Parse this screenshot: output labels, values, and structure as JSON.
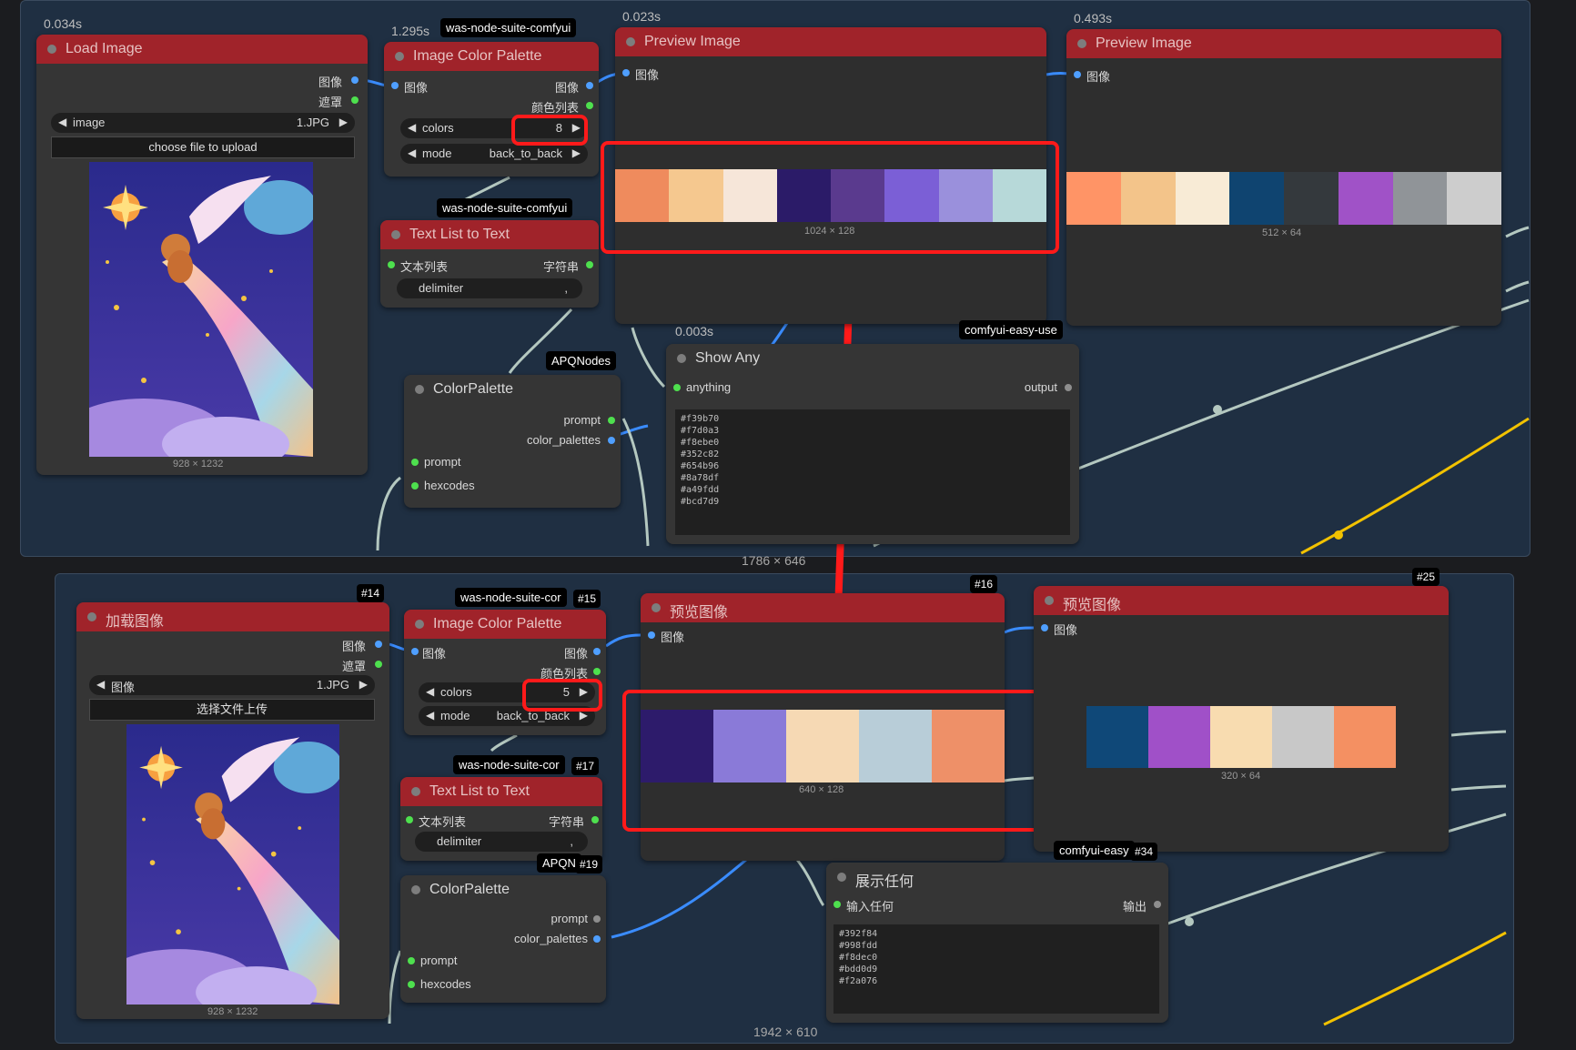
{
  "top": {
    "size_label": "1786 × 646",
    "load_image": {
      "timing": "0.034s",
      "title": "Load Image",
      "out_image": "图像",
      "out_mask": "遮罩",
      "image_label": "image",
      "image_value": "1.JPG",
      "upload_label": "choose file to upload",
      "dims": "928 × 1232"
    },
    "color_palette_node": {
      "timing": "1.295s",
      "badge": "was-node-suite-comfyui",
      "title": "Image Color Palette",
      "in_image": "图像",
      "out_image": "图像",
      "out_list": "颜色列表",
      "colors_label": "colors",
      "colors_value": "8",
      "mode_label": "mode",
      "mode_value": "back_to_back"
    },
    "text_list": {
      "badge": "was-node-suite-comfyui",
      "title": "Text List to Text",
      "in_label": "文本列表",
      "out_label": "字符串",
      "delimiter_label": "delimiter",
      "delimiter_value": ","
    },
    "apq_badge": "APQNodes",
    "colorpalette": {
      "title": "ColorPalette",
      "out_prompt": "prompt",
      "out_palettes": "color_palettes",
      "in_prompt": "prompt",
      "in_hexcodes": "hexcodes"
    },
    "preview1": {
      "timing": "0.023s",
      "title": "Preview Image",
      "in_image": "图像",
      "dims": "1024 × 128",
      "colors": [
        "#ef8b5d",
        "#f5c88f",
        "#f6e6d9",
        "#2b1b68",
        "#5a3a8e",
        "#7b5fd6",
        "#9a90dc",
        "#b7d9d9"
      ]
    },
    "preview2": {
      "timing": "0.493s",
      "title": "Preview Image",
      "in_image": "图像",
      "dims": "512 × 64",
      "colors": [
        "#ff9466",
        "#f3c48a",
        "#f8ebd6",
        "#0f4470",
        "#34393d",
        "#a052c7",
        "#909498",
        "#cdcdcd"
      ]
    },
    "show_any": {
      "timing": "0.003s",
      "badge": "comfyui-easy-use",
      "title": "Show Any",
      "in_label": "anything",
      "out_label": "output",
      "hexcodes": [
        "#f39b70",
        "#f7d0a3",
        "#f8ebe0",
        "#352c82",
        "#654b96",
        "#8a78df",
        "#a49fdd",
        "#bcd7d9"
      ]
    }
  },
  "bottom": {
    "size_label": "1942 × 610",
    "load_image": {
      "tag": "#14",
      "title": "加载图像",
      "out_image": "图像",
      "out_mask": "遮罩",
      "image_label": "图像",
      "image_value": "1.JPG",
      "upload_label": "选择文件上传",
      "dims": "928 × 1232"
    },
    "color_palette_node": {
      "badge": "was-node-suite-cor",
      "tag": "#15",
      "title": "Image Color Palette",
      "in_image": "图像",
      "out_image": "图像",
      "out_list": "颜色列表",
      "colors_label": "colors",
      "colors_value": "5",
      "mode_label": "mode",
      "mode_value": "back_to_back"
    },
    "text_list": {
      "badge": "was-node-suite-cor",
      "tag": "#17",
      "title": "Text List to Text",
      "in_label": "文本列表",
      "out_label": "字符串",
      "delimiter_label": "delimiter",
      "delimiter_value": ","
    },
    "apq": {
      "badge": "APQN",
      "tag": "#19"
    },
    "colorpalette": {
      "title": "ColorPalette",
      "out_prompt": "prompt",
      "out_palettes": "color_palettes",
      "in_prompt": "prompt",
      "in_hexcodes": "hexcodes"
    },
    "preview1": {
      "tag": "#16",
      "title": "预览图像",
      "in_image": "图像",
      "dims": "640 × 128",
      "colors": [
        "#2d1b6b",
        "#8a7ad8",
        "#f6d9b4",
        "#b8cdd8",
        "#ee9068"
      ]
    },
    "preview2": {
      "tag": "#25",
      "title": "预览图像",
      "in_image": "图像",
      "dims": "320 × 64",
      "colors": [
        "#0f4878",
        "#a050c8",
        "#f8dcb0",
        "#c8c8c8",
        "#f49062"
      ]
    },
    "show_any": {
      "badge": "comfyui-easy",
      "tag": "#34",
      "title": "展示任何",
      "in_label": "输入任何",
      "out_label": "输出",
      "hexcodes": [
        "#392f84",
        "#998fdd",
        "#f8dec0",
        "#bdd0d9",
        "#f2a076"
      ]
    }
  },
  "colors": {
    "node_title_red": "#a0232a",
    "highlight": "#ff1a1a",
    "wire_blue": "#3a8cff",
    "wire_grey": "#b4c8c0",
    "wire_yellow": "#f2c200"
  }
}
